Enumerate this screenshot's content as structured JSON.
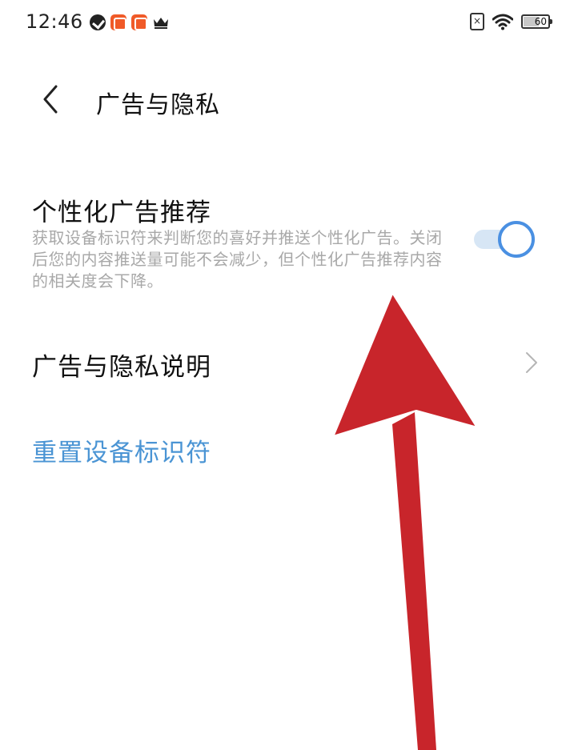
{
  "status_bar": {
    "time": "12:46",
    "battery": "60",
    "sim_status": "×",
    "icons_left": [
      "check-badge-icon",
      "app-icon",
      "app-icon",
      "crown-icon"
    ],
    "icons_right": [
      "sim-off-icon",
      "wifi-icon",
      "battery-icon"
    ]
  },
  "header": {
    "title": "广告与隐私",
    "back_icon": "chevron-left-icon"
  },
  "settings": {
    "personalized_ads": {
      "title": "个性化广告推荐",
      "description": "获取设备标识符来判断您的喜好并推送个性化广告。关闭后您的内容推送量可能不会减少，但个性化广告推荐内容的相关度会下降。",
      "enabled": true
    },
    "privacy_policy": {
      "title": "广告与隐私说明",
      "icon": "chevron-right-icon"
    },
    "reset_id": {
      "title": "重置设备标识符"
    }
  },
  "colors": {
    "accent": "#4a90e2",
    "link": "#4a94d4",
    "description": "#a8a8a8",
    "annotation_arrow": "#c8252b"
  }
}
